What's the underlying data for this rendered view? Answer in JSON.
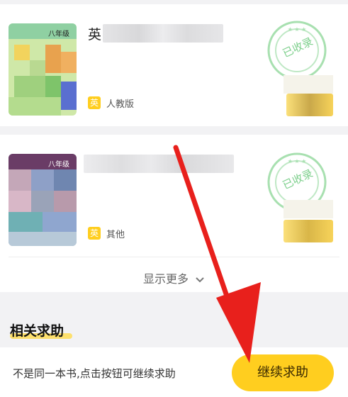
{
  "results": [
    {
      "title_prefix": "英",
      "cover_grade": "八年级",
      "subject_badge": "英",
      "edition": "人教版",
      "stamp_text": "已收录"
    },
    {
      "title_prefix": "",
      "cover_grade": "八年级",
      "subject_badge": "英",
      "edition": "其他",
      "stamp_text": "已收录"
    }
  ],
  "show_more": {
    "label": "显示更多",
    "icon": "chevron-down-icon"
  },
  "related": {
    "title": "相关求助"
  },
  "bottom": {
    "hint": "不是同一本书,点击按钮可继续求助",
    "button_label": "继续求助"
  },
  "colors": {
    "accent": "#ffce1f",
    "stamp_green": "#7ccf8b",
    "arrow_red": "#e8201c"
  }
}
